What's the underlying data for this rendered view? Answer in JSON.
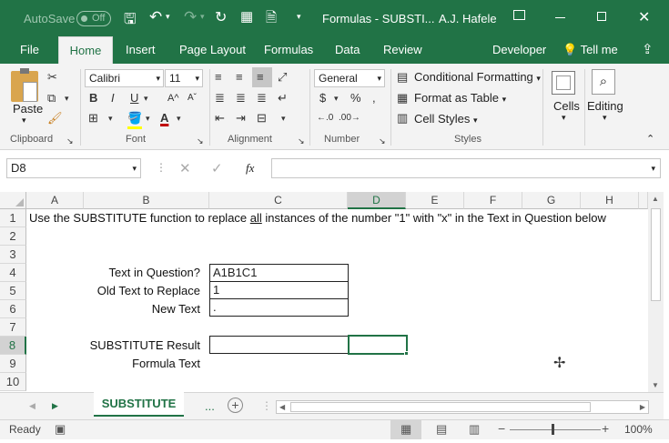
{
  "titlebar": {
    "autosave_label": "AutoSave",
    "autosave_state": "Off",
    "title": "Formulas - SUBSTI...",
    "user": "A.J. Hafele"
  },
  "tabs": [
    "File",
    "Home",
    "Insert",
    "Page Layout",
    "Formulas",
    "Data",
    "Review",
    "Developer"
  ],
  "tell_me": "Tell me",
  "ribbon": {
    "clipboard": {
      "paste": "Paste",
      "label": "Clipboard"
    },
    "font": {
      "name": "Calibri",
      "size": "11",
      "bold": "B",
      "italic": "I",
      "underline": "U",
      "label": "Font"
    },
    "alignment": {
      "label": "Alignment"
    },
    "number": {
      "format": "General",
      "label": "Number"
    },
    "styles": {
      "conditional": "Conditional Formatting",
      "table": "Format as Table",
      "cell": "Cell Styles",
      "label": "Styles"
    },
    "cells": {
      "label": "Cells"
    },
    "editing": {
      "label": "Editing"
    }
  },
  "formula_bar": {
    "name_box": "D8",
    "fx": "fx",
    "content": ""
  },
  "columns": [
    "A",
    "B",
    "C",
    "D",
    "E",
    "F",
    "G",
    "H"
  ],
  "rows": [
    "1",
    "2",
    "3",
    "4",
    "5",
    "6",
    "7",
    "8",
    "9",
    "10"
  ],
  "cells": {
    "a1": "Use the SUBSTITUTE function to replace ",
    "a1_underlined": "all",
    "a1_rest": " instances of the number \"1\" with \"x\" in the Text in Question below",
    "b4": "Text in Question?",
    "c4": "A1B1C1",
    "b5": "Old Text to Replace",
    "c5": "1",
    "b6": "New Text",
    "c6": ".",
    "b8": "SUBSTITUTE Result",
    "c8": "",
    "b9": "Formula Text"
  },
  "sheet_tabs": {
    "active": "SUBSTITUTE",
    "more": "..."
  },
  "status": {
    "ready": "Ready",
    "zoom": "100%"
  }
}
